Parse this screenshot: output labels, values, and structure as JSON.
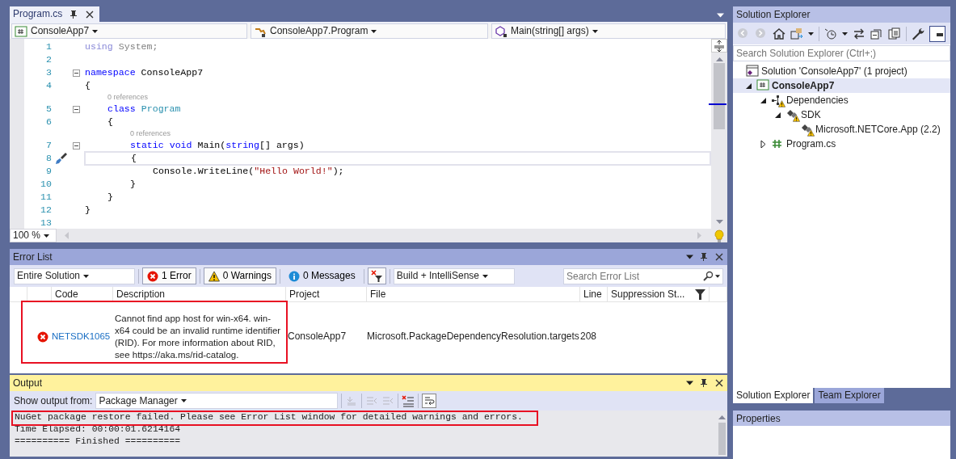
{
  "editor": {
    "tab": {
      "title": "Program.cs",
      "selected": true
    },
    "navigation": [
      {
        "kind": "project",
        "text": "ConsoleApp7"
      },
      {
        "kind": "class",
        "text": "ConsoleApp7.Program"
      },
      {
        "kind": "method",
        "text": "Main(string[] args)"
      }
    ],
    "lines": [
      {
        "kind": "code",
        "number": "1",
        "foldable": false,
        "current": false,
        "quick_action": false,
        "tokens": [
          {
            "kind": "unused_keyword",
            "text": "using"
          },
          {
            "kind": "unused",
            "text": " System;"
          }
        ]
      },
      {
        "kind": "code",
        "number": "2",
        "foldable": false,
        "current": false,
        "quick_action": false
      },
      {
        "kind": "code",
        "number": "3",
        "foldable": true,
        "current": false,
        "quick_action": false,
        "tokens": [
          {
            "kind": "keyword",
            "text": "namespace"
          },
          {
            "kind": "plain",
            "text": " ConsoleApp7"
          }
        ]
      },
      {
        "kind": "code",
        "number": "4",
        "foldable": false,
        "current": false,
        "quick_action": false,
        "tokens": [
          {
            "kind": "plain",
            "text": "{"
          }
        ]
      },
      {
        "kind": "codelens",
        "text": "    0 references"
      },
      {
        "kind": "code",
        "number": "5",
        "foldable": true,
        "current": false,
        "quick_action": false,
        "tokens": [
          {
            "kind": "keyword",
            "text": "    class"
          },
          {
            "kind": "type",
            "text": " Program"
          }
        ]
      },
      {
        "kind": "code",
        "number": "6",
        "foldable": false,
        "current": false,
        "quick_action": false,
        "tokens": [
          {
            "kind": "plain",
            "text": "    {"
          }
        ]
      },
      {
        "kind": "codelens",
        "text": "        0 references"
      },
      {
        "kind": "code",
        "number": "7",
        "foldable": true,
        "current": false,
        "quick_action": false,
        "tokens": [
          {
            "kind": "keyword",
            "text": "        static void"
          },
          {
            "kind": "plain",
            "text": " Main("
          },
          {
            "kind": "keyword",
            "text": "string"
          },
          {
            "kind": "plain",
            "text": "[] args)"
          }
        ]
      },
      {
        "kind": "code",
        "number": "8",
        "foldable": false,
        "current": true,
        "quick_action": true,
        "tokens": [
          {
            "kind": "plain",
            "text": "        {"
          }
        ]
      },
      {
        "kind": "code",
        "number": "9",
        "foldable": false,
        "current": false,
        "quick_action": false,
        "tokens": [
          {
            "kind": "plain",
            "text": "            Console.WriteLine("
          },
          {
            "kind": "string",
            "text": "\"Hello World!\""
          },
          {
            "kind": "plain",
            "text": ");"
          }
        ]
      },
      {
        "kind": "code",
        "number": "10",
        "foldable": false,
        "current": false,
        "quick_action": false,
        "tokens": [
          {
            "kind": "plain",
            "text": "        }"
          }
        ]
      },
      {
        "kind": "code",
        "number": "11",
        "foldable": false,
        "current": false,
        "quick_action": false,
        "tokens": [
          {
            "kind": "plain",
            "text": "    }"
          }
        ]
      },
      {
        "kind": "code",
        "number": "12",
        "foldable": false,
        "current": false,
        "quick_action": false,
        "tokens": [
          {
            "kind": "plain",
            "text": "}"
          }
        ]
      },
      {
        "kind": "code",
        "number": "13",
        "foldable": false,
        "current": false,
        "quick_action": false
      }
    ],
    "zoom": "100 %"
  },
  "error_list": {
    "title": "Error List",
    "scope": "Entire Solution",
    "filters": [
      {
        "kind": "error",
        "label": "1 Error",
        "selected": true
      },
      {
        "kind": "warning",
        "label": "0 Warnings",
        "selected": true
      },
      {
        "kind": "message",
        "label": "0 Messages",
        "selected": false
      }
    ],
    "source": "Build + IntelliSense",
    "search": {
      "placeholder": "Search Error List"
    },
    "columns": [
      "Code",
      "Description",
      "Project",
      "File",
      "Line",
      "Suppression St..."
    ],
    "rows": [
      {
        "kind": "error",
        "code": "NETSDK1065",
        "description": "Cannot find app host for win-x64. win-x64 could be an invalid runtime identifier (RID). For more information about RID, see https://aka.ms/rid-catalog.",
        "project": "ConsoleApp7",
        "file": "Microsoft.PackageDependencyResolution.targets",
        "line": "208",
        "highlighted": true
      }
    ]
  },
  "output": {
    "title": "Output",
    "source_label": "Show output from:",
    "source": "Package Manager",
    "lines": [
      {
        "text": "NuGet package restore failed. Please see Error List window for detailed warnings and errors.",
        "highlighted": true
      },
      {
        "text": "Time Elapsed: 00:00:01.6214164",
        "highlighted": false
      },
      {
        "text": "========== Finished ==========",
        "highlighted": false
      }
    ]
  },
  "solution_explorer": {
    "title": "Solution Explorer",
    "search": {
      "placeholder": "Search Solution Explorer (Ctrl+;)"
    },
    "tree": [
      {
        "kind": "solution",
        "label": "Solution 'ConsoleApp7' (1 project)",
        "selected": false,
        "warning": false,
        "children": [
          {
            "kind": "project",
            "label": "ConsoleApp7",
            "expanded": true,
            "selected": true,
            "warning": false,
            "children": [
              {
                "kind": "dependencies",
                "label": "Dependencies",
                "expanded": true,
                "selected": false,
                "warning": true,
                "children": [
                  {
                    "kind": "sdk",
                    "label": "SDK",
                    "expanded": true,
                    "selected": false,
                    "warning": true,
                    "children": [
                      {
                        "kind": "package",
                        "label": "Microsoft.NETCore.App (2.2)",
                        "selected": false,
                        "warning": true
                      }
                    ]
                  }
                ]
              },
              {
                "kind": "file",
                "label": "Program.cs",
                "expanded": false,
                "selected": false,
                "warning": false
              }
            ]
          }
        ]
      }
    ]
  },
  "bottom_tabs": [
    {
      "label": "Solution Explorer",
      "selected": true
    },
    {
      "label": "Team Explorer",
      "selected": false
    }
  ],
  "properties": {
    "title": "Properties"
  }
}
